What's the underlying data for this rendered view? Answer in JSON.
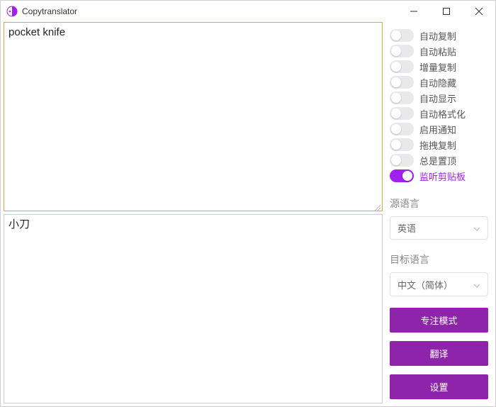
{
  "window": {
    "title": "Copytranslator"
  },
  "source": {
    "text": "pocket knife"
  },
  "output": {
    "text": "小刀"
  },
  "toggles": [
    {
      "key": "auto_copy",
      "label": "自动复制",
      "on": false
    },
    {
      "key": "auto_paste",
      "label": "自动粘贴",
      "on": false
    },
    {
      "key": "inc_copy",
      "label": "增量复制",
      "on": false
    },
    {
      "key": "auto_hide",
      "label": "自动隐藏",
      "on": false
    },
    {
      "key": "auto_show",
      "label": "自动显示",
      "on": false
    },
    {
      "key": "auto_format",
      "label": "自动格式化",
      "on": false
    },
    {
      "key": "enable_notify",
      "label": "启用通知",
      "on": false
    },
    {
      "key": "drag_copy",
      "label": "拖拽复制",
      "on": false
    },
    {
      "key": "always_top",
      "label": "总是置顶",
      "on": false
    },
    {
      "key": "listen_clip",
      "label": "监听剪贴板",
      "on": true
    }
  ],
  "labels": {
    "source_lang_section": "源语言",
    "target_lang_section": "目标语言"
  },
  "source_lang": {
    "selected": "英语"
  },
  "target_lang": {
    "selected": "中文（简体）"
  },
  "buttons": {
    "focus_mode": "专注模式",
    "translate": "翻译",
    "settings": "设置"
  },
  "colors": {
    "accent": "#8e24aa",
    "toggle_on": "#a020f0",
    "source_border": "#e6a23c"
  }
}
